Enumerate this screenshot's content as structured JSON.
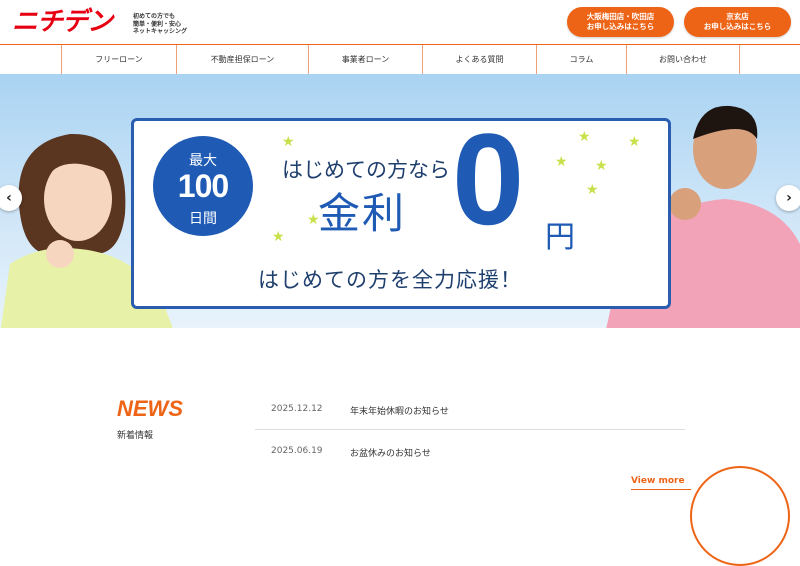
{
  "header": {
    "logo": "ニチデン",
    "tagline": [
      "初めての方でも",
      "簡単・便利・安心",
      "ネットキャッシング"
    ],
    "cta": [
      {
        "line1": "大阪梅田店・吹田店",
        "line2": "お申し込みはこちら"
      },
      {
        "line1": "京玄店",
        "line2": "お申し込みはこちら"
      }
    ]
  },
  "nav": {
    "items": [
      "フリーローン",
      "不動産担保ローン",
      "事業者ローン",
      "よくある質問",
      "コラム",
      "お問い合わせ"
    ]
  },
  "hero": {
    "badge_top": "最大",
    "badge_mid": "100",
    "badge_bot": "日間",
    "line1": "はじめての方なら",
    "kinri": "金利",
    "zero": "0",
    "en": "円",
    "line2": "はじめての方を全力応援！",
    "arrow_left": "‹",
    "arrow_right": "›"
  },
  "news": {
    "title": "NEWS",
    "subtitle": "新着情報",
    "items": [
      {
        "date": "2025.12.12",
        "text": "年末年始休暇のお知らせ"
      },
      {
        "date": "2025.06.19",
        "text": "お盆休みのお知らせ"
      }
    ],
    "view_more": "View more"
  },
  "colors": {
    "brand_red": "#e60012",
    "accent_orange": "#ee6417",
    "hero_blue": "#1f5bb5"
  }
}
